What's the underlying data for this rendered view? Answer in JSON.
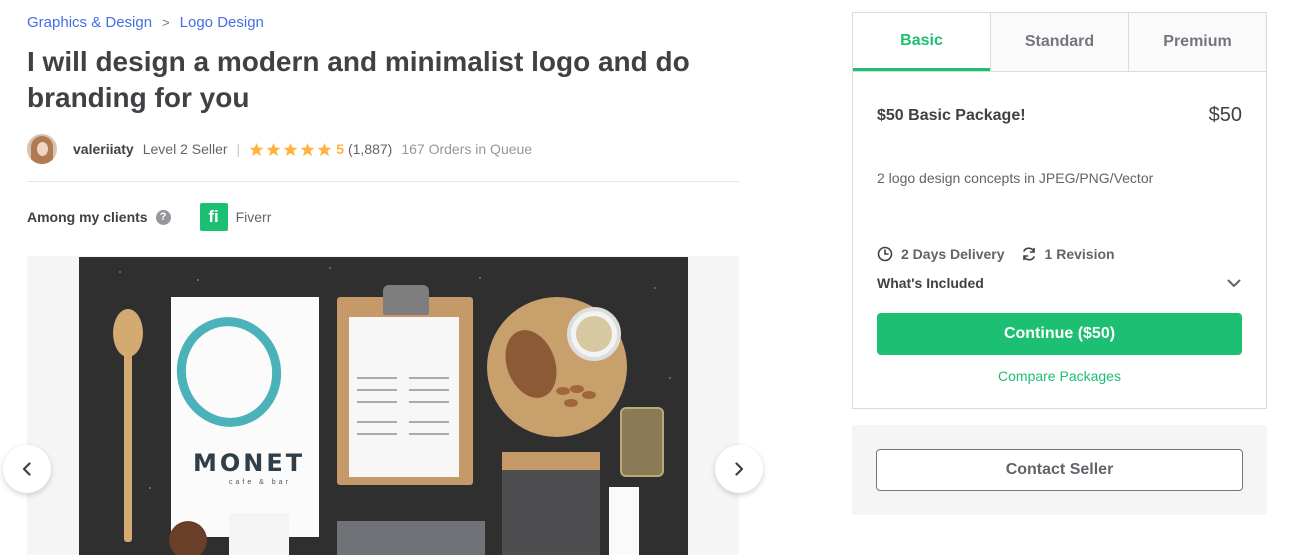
{
  "breadcrumb": {
    "items": [
      "Graphics & Design",
      "Logo Design"
    ],
    "separator": ">"
  },
  "gig": {
    "title": "I will design a modern and minimalist logo and do branding for you"
  },
  "seller": {
    "name": "valeriiaty",
    "level": "Level 2 Seller",
    "rating": "5",
    "rating_value": 5,
    "rating_count": "(1,887)",
    "queue": "167 Orders in Queue"
  },
  "clients": {
    "label": "Among my clients",
    "help_icon": "question-icon",
    "client_logo_text": "fi",
    "client_name": "Fiverr"
  },
  "gallery": {
    "prev_icon": "chevron-left-icon",
    "next_icon": "chevron-right-icon",
    "image": {
      "brand": "MONET",
      "brand_sub": "cafe & bar"
    }
  },
  "package": {
    "tabs": [
      "Basic",
      "Standard",
      "Premium"
    ],
    "active_tab": "Basic",
    "title": "$50 Basic Package!",
    "price": "$50",
    "description": "2 logo design concepts in JPEG/PNG/Vector",
    "delivery": "2 Days Delivery",
    "revisions": "1 Revision",
    "included_label": "What's Included",
    "continue_label": "Continue ($50)",
    "compare_label": "Compare Packages"
  },
  "contact": {
    "label": "Contact Seller"
  },
  "colors": {
    "accent": "#1dbf73",
    "link": "#446ee7",
    "star": "#ffb33e",
    "text": "#404145"
  }
}
